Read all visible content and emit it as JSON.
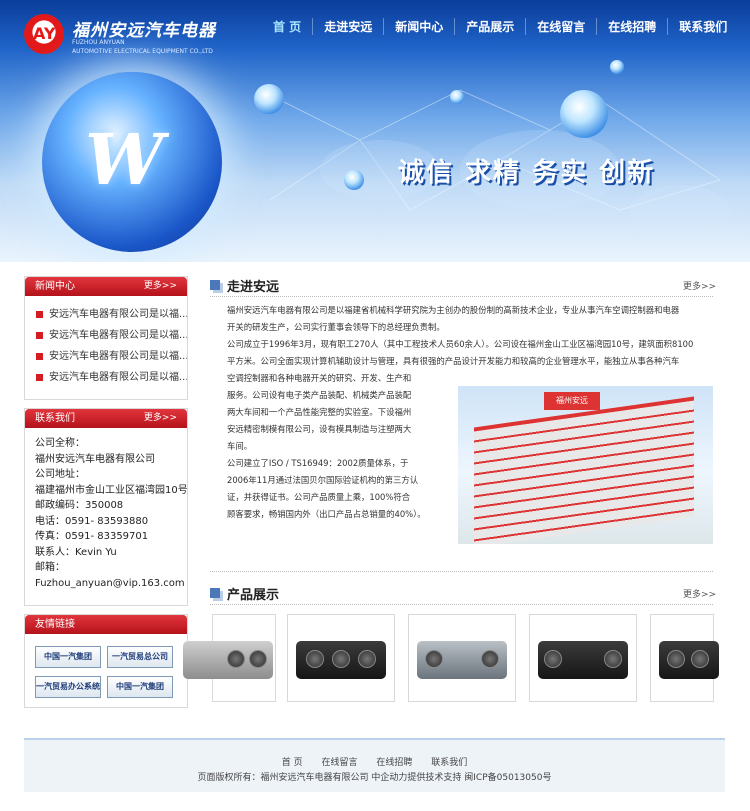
{
  "header": {
    "company_cn": "福州安远汽车电器",
    "company_en_line1": "FUZHOU ANYUAN",
    "company_en_line2": "AUTOMOTIVE ELECTRICAL EQUIPMENT CO.,LTD",
    "slogan": "诚信  求精  务实  创新",
    "globe_letter": "W",
    "nav": [
      "首 页",
      "走进安远",
      "新闻中心",
      "产品展示",
      "在线留言",
      "在线招聘",
      "联系我们"
    ]
  },
  "news_box": {
    "title": "新闻中心",
    "more": "更多>>",
    "items": [
      "安远汽车电器有限公司是以福...",
      "安远汽车电器有限公司是以福...",
      "安远汽车电器有限公司是以福...",
      "安远汽车电器有限公司是以福..."
    ]
  },
  "contact_box": {
    "title": "联系我们",
    "more": "更多>>",
    "lines": [
      "公司全称：",
      "福州安远汽车电器有限公司",
      "公司地址：",
      "福建福州市金山工业区福湾园10号",
      "邮政编码：350008",
      "电话：0591- 83593880",
      "传真：0591- 83359701",
      "联系人：Kevin Yu",
      "邮箱：",
      "Fuzhou_anyuan@vip.163.com"
    ]
  },
  "links_box": {
    "title": "友情链接",
    "items": [
      "中国一汽集团",
      "一汽贸易总公司",
      "一汽贸易办公系统",
      "中国一汽集团"
    ]
  },
  "about": {
    "title": "走进安远",
    "more": "更多>>",
    "para_full": [
      "福州安远汽车电器有限公司是以福建省机械科学研究院为主创办的股份制的高新技术企业，专业从事汽车空调控制器和电器",
      "开关的研发生产，公司实行董事会领导下的总经理负责制。",
      "公司成立于1996年3月，现有职工270人（其中工程技术人员60余人）。公司设在福州金山工业区福湾园10号，建筑面积8100",
      "平方米。公司全面实现计算机辅助设计与管理，具有很强的产品设计开发能力和较高的企业管理水平，能独立从事各种汽车"
    ],
    "para_left": [
      "空调控制器和各种电器开关的研究、开发、生产和",
      "服务。公司设有电子类产品装配、机械类产品装配",
      "两大车间和一个产品性能完整的实验室。下设福州",
      "安远精密制模有限公司，设有模具制造与注塑两大",
      "车间。",
      "公司建立了ISO / TS16949：2002质量体系，于",
      "2006年11月通过法国贝尔国际验证机构的第三方认",
      "证，并获得证书。公司产品质量上乘，100%符合",
      "顾客要求，畅销国内外（出口产品占总销量的40%）。"
    ],
    "building_sign": "福州安远"
  },
  "products": {
    "title": "产品展示",
    "more": "更多>>"
  },
  "footer": {
    "nav": [
      "首 页",
      "在线留言",
      "在线招聘",
      "联系我们"
    ],
    "copyright": "页面版权所有：福州安远汽车电器有限公司    中企动力提供技术支持    闽ICP备05013050号"
  }
}
